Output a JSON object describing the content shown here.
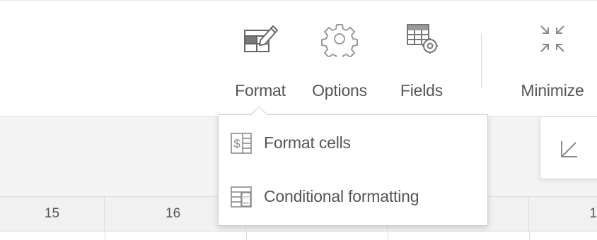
{
  "toolbar": {
    "format_label": "Format",
    "options_label": "Options",
    "fields_label": "Fields",
    "minimize_label": "Minimize"
  },
  "dropdown": {
    "items": [
      {
        "label": "Format cells",
        "icon": "dollar-table-icon"
      },
      {
        "label": "Conditional formatting",
        "icon": "conditional-table-icon"
      }
    ]
  },
  "grid": {
    "columns": [
      "15",
      "16",
      "1"
    ]
  },
  "colors": {
    "text": "#555555",
    "icon": "#8a8a8a",
    "border": "#d8d8d8"
  }
}
